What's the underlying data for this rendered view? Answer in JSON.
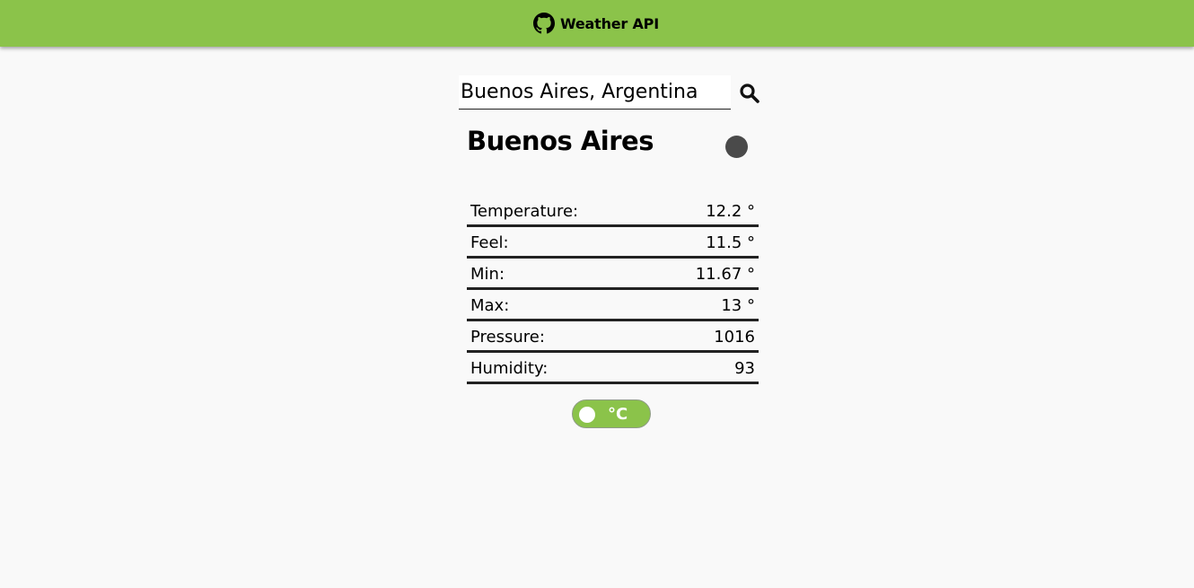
{
  "header": {
    "title": "Weather API",
    "icon": "github-icon",
    "background_color": "#8bc34a"
  },
  "search": {
    "value": "Buenos Aires, Argentina",
    "icon": "search-icon"
  },
  "city": {
    "name": "Buenos Aires",
    "weather_icon": "weather-icon"
  },
  "stats": [
    {
      "label": "Temperature:",
      "value": "12.2 °"
    },
    {
      "label": "Feel:",
      "value": "11.5 °"
    },
    {
      "label": "Min:",
      "value": "11.67 °"
    },
    {
      "label": "Max:",
      "value": "13 °"
    },
    {
      "label": "Pressure:",
      "value": "1016"
    },
    {
      "label": "Humidity:",
      "value": "93"
    }
  ],
  "unit_toggle": {
    "label": "°C",
    "color": "#8bc34a"
  }
}
